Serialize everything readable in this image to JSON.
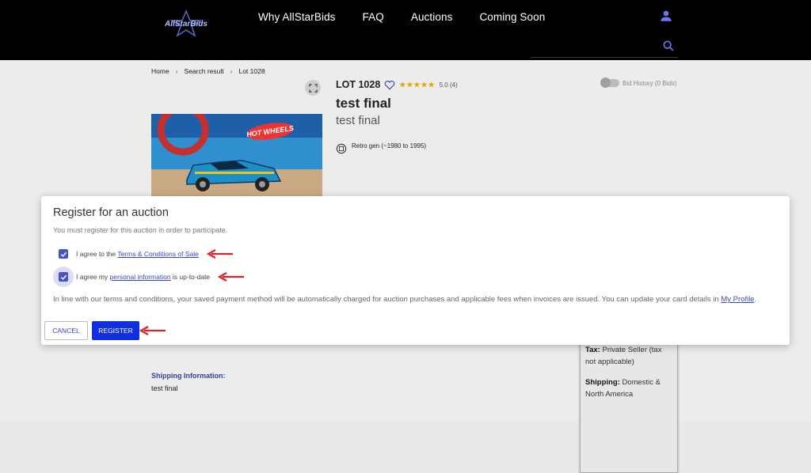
{
  "header": {
    "logo_text": "AllStarBids",
    "nav": [
      "Why AllStarBids",
      "FAQ",
      "Auctions",
      "Coming Soon"
    ],
    "icons": [
      "user-icon",
      "search-icon"
    ],
    "search_placeholder": ""
  },
  "breadcrumb": [
    "Home",
    "Search result",
    "Lot 1028"
  ],
  "lot": {
    "lot_label": "LOT 1028",
    "stars": "★★★★★",
    "rating": "5.0 (4)",
    "title": "test final",
    "subtitle": "test final",
    "era": "Retro gen (~1980 to 1995)",
    "bid_history_toggle": "Bid History (0 Bids)"
  },
  "shipping": {
    "heading": "Shipping Information:",
    "value": "test final"
  },
  "side_box": {
    "tax_label": "Tax:",
    "tax_value": "Private Seller (tax not applicable)",
    "shipping_label": "Shipping:",
    "shipping_value": "Domestic & North America"
  },
  "modal": {
    "title": "Register for an auction",
    "subtitle": "You must register for this auction in order to participate.",
    "terms_prefix": "I agree to the ",
    "terms_link": "Terms & Conditions of Sale",
    "info_prefix": "I agree my ",
    "info_link": "personal information",
    "info_suffix": " is up-to-date",
    "notice": "In line with our terms and conditions, your saved payment method will be automatically charged for auction purchases and applicable fees when invoices are issued. You can update your card details in ",
    "notice_link": "My Profile",
    "notice_end": ".",
    "cancel_label": "CANCEL",
    "register_label": "REGISTER",
    "terms_checked": true,
    "info_checked": true
  },
  "colors": {
    "accent": "#4a52c8",
    "primary_button": "#0f2fe0",
    "annotation_arrow": "#e0202a"
  }
}
